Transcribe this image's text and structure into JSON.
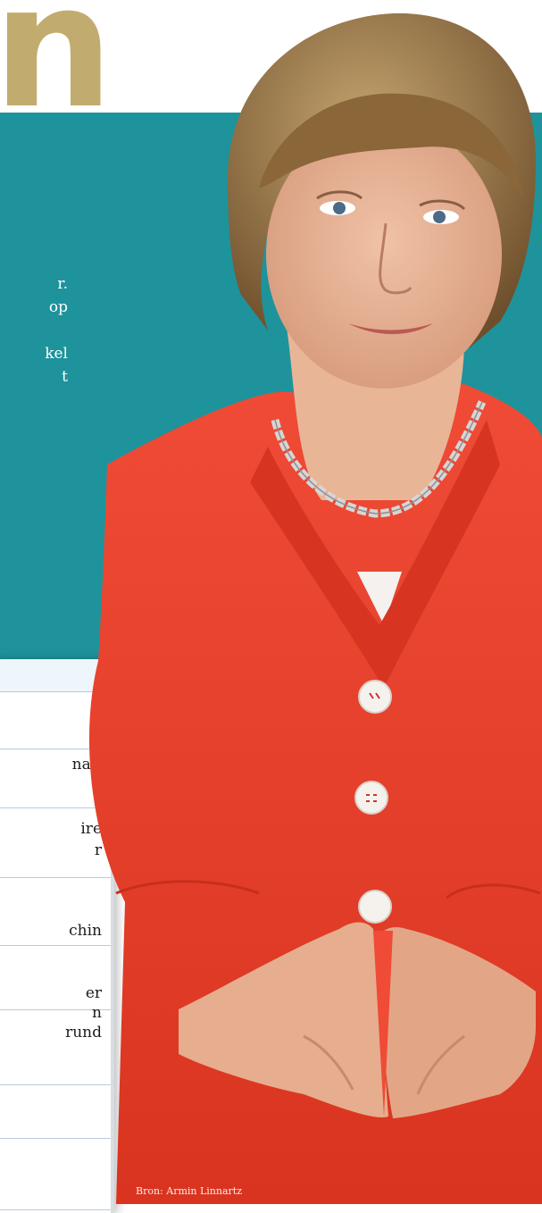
{
  "heading": {
    "fragment": "n"
  },
  "intro": {
    "lines": [
      "r.",
      "op",
      "",
      "kel",
      "t"
    ]
  },
  "box": {
    "lines": [
      "nat,",
      "ire",
      "r",
      "chin",
      "er",
      "n",
      "rund"
    ]
  },
  "photo": {
    "credit": "Bron: Armin Linnartz"
  },
  "colors": {
    "teal": "#1e939b",
    "gold": "#c2ab6e",
    "jacket": "#e8402e"
  }
}
